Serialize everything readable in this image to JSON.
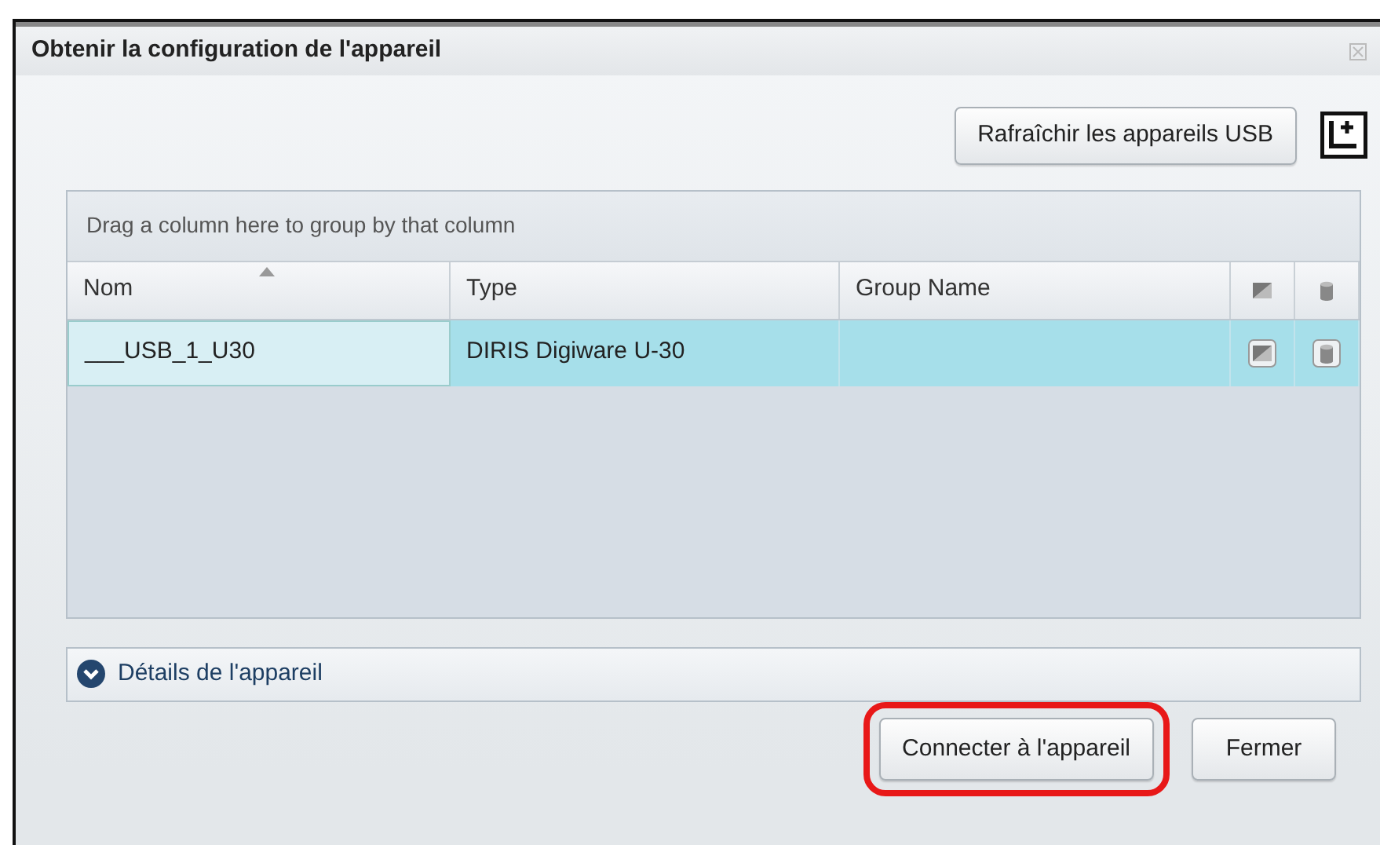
{
  "window": {
    "title": "Obtenir la configuration de l'appareil"
  },
  "toolbar": {
    "refresh_button": "Rafraîchir les appareils USB"
  },
  "grid": {
    "group_hint": "Drag a column here to group by that column",
    "columns": [
      {
        "label": "Nom",
        "kind": "text",
        "sorted": true
      },
      {
        "label": "Type",
        "kind": "text",
        "sorted": false
      },
      {
        "label": "Group Name",
        "kind": "text",
        "sorted": false
      },
      {
        "kind": "export-icon",
        "sorted": false
      },
      {
        "kind": "db-icon",
        "sorted": false
      }
    ],
    "rows": [
      {
        "selected": true,
        "cells": [
          "___USB_1_U30",
          "DIRIS Digiware U-30",
          ""
        ]
      }
    ]
  },
  "details": {
    "label": "Détails de l'appareil",
    "expanded": false
  },
  "buttons": [
    {
      "label": "Connecter à l'appareil",
      "highlighted": true
    },
    {
      "label": "Fermer",
      "highlighted": false
    }
  ]
}
